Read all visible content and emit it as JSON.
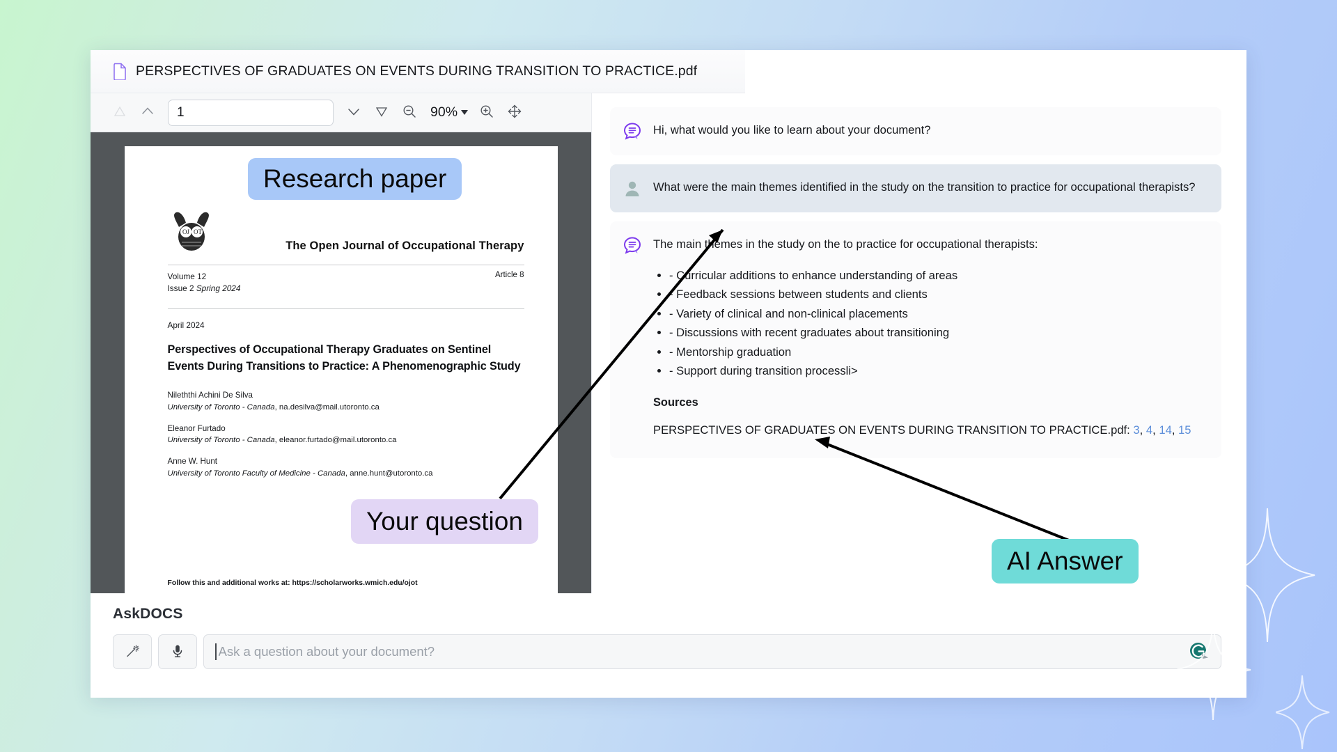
{
  "window": {
    "title": "PERSPECTIVES OF GRADUATES ON EVENTS DURING TRANSITION TO PRACTICE.pdf",
    "doc_icon": "document-icon"
  },
  "pdf_toolbar": {
    "first_page_icon": "triangle-up-icon",
    "prev_page_icon": "chevron-up-icon",
    "page_number": "1",
    "next_page_icon": "chevron-down-icon",
    "last_page_icon": "triangle-down-icon",
    "zoom_out_icon": "zoom-out-icon",
    "zoom_level": "90%",
    "zoom_caret_icon": "chevron-down-icon",
    "zoom_in_icon": "zoom-in-icon",
    "pan_icon": "move-tool-icon"
  },
  "pdf_page": {
    "logo_text": "OJOT",
    "journal_name": "The Open Journal of Occupational Therapy",
    "volume": "Volume 12",
    "issue_label": "Issue 2 ",
    "issue_season": "Spring 2024",
    "article_number": "Article 8",
    "date": "April 2024",
    "title": "Perspectives of Occupational Therapy Graduates on Sentinel Events During Transitions to Practice: A Phenomenographic Study",
    "authors": [
      {
        "name": "Nileththi Achini De Silva",
        "affiliation": "University of Toronto - Canada",
        "email": "na.desilva@mail.utoronto.ca"
      },
      {
        "name": "Eleanor Furtado",
        "affiliation": "University of Toronto - Canada",
        "email": "eleanor.furtado@mail.utoronto.ca"
      },
      {
        "name": "Anne W. Hunt",
        "affiliation": "University of Toronto Faculty of Medicine - Canada",
        "email": "anne.hunt@utoronto.ca"
      }
    ],
    "footer": "Follow this and additional works at: https://scholarworks.wmich.edu/ojot"
  },
  "chat": {
    "greeting": "Hi, what would you like to learn about your document?",
    "user_question": "What were the main themes identified in the study on the transition to practice for occupational therapists?",
    "answer_intro": "The main themes in the study on the to practice for occupational therapists:",
    "answer_bullets": [
      "- Curricular additions to enhance understanding of areas",
      "- Feedback sessions between students and clients",
      "- Variety of clinical and non-clinical placements",
      "- Discussions with recent graduates about transitioning",
      "- Mentorship graduation",
      "- Support during transition processli>"
    ],
    "sources_heading": "Sources",
    "source_document": "PERSPECTIVES OF GRADUATES ON EVENTS DURING TRANSITION TO PRACTICE.pdf:",
    "source_pages": [
      "3",
      "4",
      "14",
      "15"
    ],
    "bot_avatar": "bot-document-icon",
    "user_avatar": "user-avatar-icon"
  },
  "composer": {
    "brand": "AskDOCS",
    "magic_icon": "magic-wand-icon",
    "mic_icon": "microphone-icon",
    "placeholder": "Ask a question about your document?",
    "value": "",
    "assistant_icon": "grammarly-icon"
  },
  "annotations": {
    "research_paper": "Research paper",
    "your_question": "Your question",
    "ai_answer": "AI Answer"
  },
  "colors": {
    "annotation_blue": "#a8c8f8",
    "annotation_purple": "#e2d6f5",
    "annotation_teal": "#6fdbd8",
    "user_bubble": "#e2e8ef",
    "link_blue": "#5b8dd9",
    "bot_purple": "#7c3aed"
  }
}
